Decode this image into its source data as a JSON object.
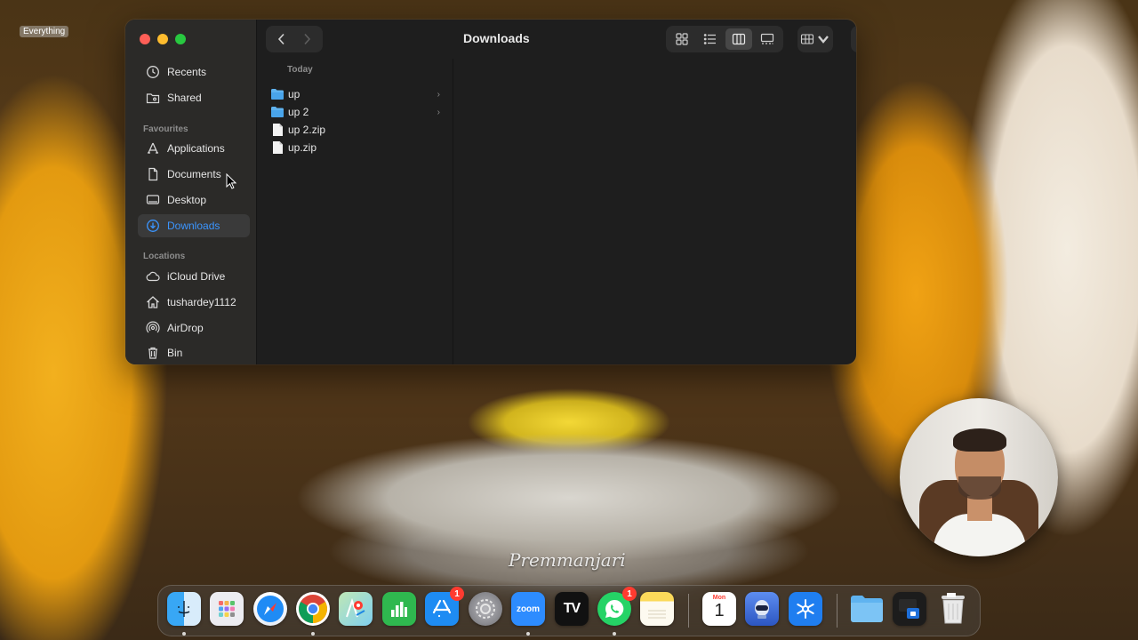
{
  "overlay": {
    "everything_tag": "Everything",
    "watermark": "Premmanjari"
  },
  "window": {
    "title": "Downloads",
    "sidebar": {
      "top_items": [
        {
          "label": "Recents",
          "icon": "clock-icon"
        },
        {
          "label": "Shared",
          "icon": "shared-folder-icon"
        }
      ],
      "favourites_title": "Favourites",
      "favourites": [
        {
          "label": "Applications",
          "icon": "applications-icon"
        },
        {
          "label": "Documents",
          "icon": "document-icon"
        },
        {
          "label": "Desktop",
          "icon": "desktop-icon"
        },
        {
          "label": "Downloads",
          "icon": "download-icon",
          "active": true
        }
      ],
      "locations_title": "Locations",
      "locations": [
        {
          "label": "iCloud Drive",
          "icon": "cloud-icon"
        },
        {
          "label": "tushardey1112",
          "icon": "home-icon"
        },
        {
          "label": "AirDrop",
          "icon": "airdrop-icon"
        },
        {
          "label": "Bin",
          "icon": "trash-icon"
        }
      ]
    },
    "column": {
      "header": "Today",
      "files": [
        {
          "name": "up",
          "kind": "folder"
        },
        {
          "name": "up 2",
          "kind": "folder"
        },
        {
          "name": "up 2.zip",
          "kind": "zip"
        },
        {
          "name": "up.zip",
          "kind": "zip"
        }
      ]
    }
  },
  "dock": {
    "apps": [
      {
        "name": "Finder",
        "icon": "finder-icon",
        "color": "#2d8cf0"
      },
      {
        "name": "Launchpad",
        "icon": "launchpad-icon",
        "color": "#e9e9ee"
      },
      {
        "name": "Safari",
        "icon": "safari-icon",
        "color": "#1e88f5"
      },
      {
        "name": "Chrome",
        "icon": "chrome-icon",
        "color": "#ffffff"
      },
      {
        "name": "Maps",
        "icon": "maps-icon",
        "color": "#5ec26a"
      },
      {
        "name": "Numbers",
        "icon": "numbers-icon",
        "color": "#2fb84f"
      },
      {
        "name": "App Store",
        "icon": "app-store-icon",
        "color": "#1e8cf3",
        "badge": "1"
      },
      {
        "name": "System Settings",
        "icon": "settings-icon",
        "color": "#8e8e93"
      },
      {
        "name": "Zoom",
        "label": "zoom",
        "icon": "zoom-icon",
        "color": "#2d8cff"
      },
      {
        "name": "TradingView",
        "label": "TV",
        "icon": "tradingview-icon",
        "color": "#111111"
      },
      {
        "name": "WhatsApp",
        "icon": "whatsapp-icon",
        "color": "#25d366",
        "badge": "1"
      },
      {
        "name": "Notes",
        "icon": "notes-icon",
        "color": "#fbe27b"
      },
      {
        "name": "Calendar",
        "icon": "calendar-icon",
        "color": "#ffffff",
        "month": "Mon",
        "day": "1"
      },
      {
        "name": "Automator",
        "icon": "automator-icon",
        "color": "#3b6fd8"
      },
      {
        "name": "Snow",
        "icon": "snowflake-icon",
        "color": "#1f7ef0"
      },
      {
        "name": "Downloads Stack",
        "icon": "folder-icon",
        "color": "#6ab8f2"
      },
      {
        "name": "Recent Stack",
        "icon": "stack-icon",
        "color": "#222222"
      },
      {
        "name": "Bin",
        "icon": "trash-icon",
        "color": "#d8d8d8"
      }
    ]
  }
}
